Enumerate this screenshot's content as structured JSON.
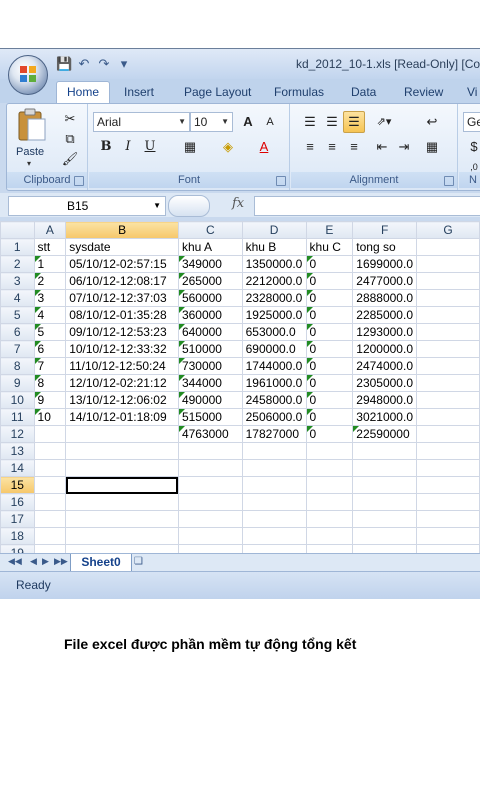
{
  "window": {
    "title": "kd_2012_10-1.xls  [Read-Only]  [Co"
  },
  "ribbon": {
    "tabs": [
      "Home",
      "Insert",
      "Page Layout",
      "Formulas",
      "Data",
      "Review",
      "Vi"
    ],
    "active_tab": "Home",
    "clipboard": {
      "paste_label": "Paste",
      "group_label": "Clipboard"
    },
    "font": {
      "name": "Arial",
      "size": "10",
      "bold": "B",
      "italic": "I",
      "underline": "U",
      "grow": "A",
      "shrink": "A",
      "font_color_letter": "A",
      "group_label": "Font"
    },
    "alignment": {
      "group_label": "Alignment"
    },
    "number": {
      "format_partial": "Ger",
      "group_label_partial": "N",
      "decimal_partial": ",0"
    }
  },
  "formula_bar": {
    "name_box": "B15",
    "fx": "fx",
    "formula": ""
  },
  "sheet": {
    "columns": [
      "A",
      "B",
      "C",
      "D",
      "E",
      "F",
      "G"
    ],
    "selected_column": "B",
    "selected_row": "15",
    "header_row": [
      "stt",
      "sysdate",
      "khu A",
      "khu B",
      "khu C",
      "tong so",
      ""
    ],
    "rows": [
      [
        "1",
        "05/10/12-02:57:15",
        "349000",
        "1350000.0",
        "0",
        "1699000.0",
        ""
      ],
      [
        "2",
        "06/10/12-12:08:17",
        "265000",
        "2212000.0",
        "0",
        "2477000.0",
        ""
      ],
      [
        "3",
        "07/10/12-12:37:03",
        "560000",
        "2328000.0",
        "0",
        "2888000.0",
        ""
      ],
      [
        "4",
        "08/10/12-01:35:28",
        "360000",
        "1925000.0",
        "0",
        "2285000.0",
        ""
      ],
      [
        "5",
        "09/10/12-12:53:23",
        "640000",
        "653000.0",
        "0",
        "1293000.0",
        ""
      ],
      [
        "6",
        "10/10/12-12:33:32",
        "510000",
        "690000.0",
        "0",
        "1200000.0",
        ""
      ],
      [
        "7",
        "11/10/12-12:50:24",
        "730000",
        "1744000.0",
        "0",
        "2474000.0",
        ""
      ],
      [
        "8",
        "12/10/12-02:21:12",
        "344000",
        "1961000.0",
        "0",
        "2305000.0",
        ""
      ],
      [
        "9",
        "13/10/12-12:06:02",
        "490000",
        "2458000.0",
        "0",
        "2948000.0",
        ""
      ],
      [
        "10",
        "14/10/12-01:18:09",
        "515000",
        "2506000.0",
        "0",
        "3021000.0",
        ""
      ]
    ],
    "total_row": [
      "",
      "",
      "4763000",
      "17827000",
      "0",
      "22590000",
      ""
    ],
    "empty_row_numbers": [
      "13",
      "14",
      "15",
      "16",
      "17",
      "18",
      "19"
    ],
    "sheet_tab": "Sheet0"
  },
  "status": {
    "text": "Ready"
  },
  "caption": "File excel được phần mềm tự động tổng kết"
}
